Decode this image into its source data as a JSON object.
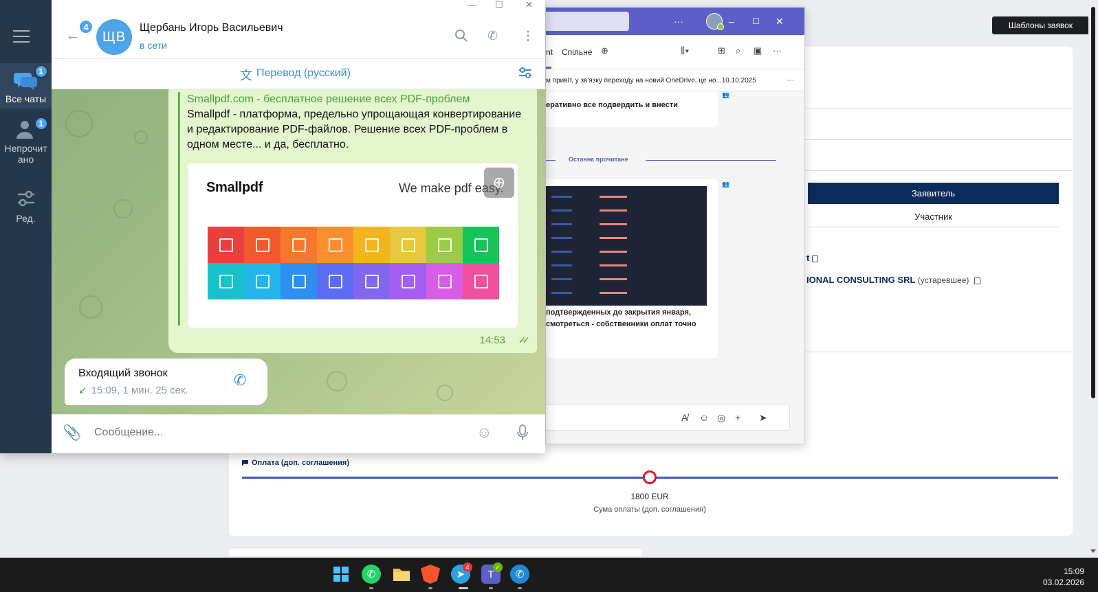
{
  "background_app": {
    "templates_button": "Шаблоны заявок",
    "roles": {
      "applicant": "Заявитель",
      "participant": "Участник"
    },
    "company_fragment_top": "t",
    "company_fragment": "IONAL CONSULTING SRL",
    "company_fragment_status": "(устаревшее)",
    "payment_label": "Оплата (доп. соглашения)",
    "payment_amount": "1800 EUR",
    "payment_caption": "Сума оплаты (доп. соглашения)"
  },
  "teams": {
    "tabs": {
      "fragment": "nt",
      "shared": "Спільне"
    },
    "banner": "м привіт, у зв'язку переходу на новий OneDrive, це но...10.10.2025",
    "message1_fragment": "еративно все подвердить и внести",
    "last_read_label": "Останнє прочитане",
    "message2_line1": "подтвержденных до закрытия января,",
    "message2_line2": "смотреться - собственники оплат точно",
    "accent_color": "#5b5fc7"
  },
  "telegram": {
    "sidebar": {
      "folders": [
        {
          "label": "Все чаты",
          "badge": "1",
          "icon": "chats-icon"
        },
        {
          "label": "Непрочитано",
          "label_lines": [
            "Непрочит",
            "ано"
          ],
          "badge": "1",
          "icon": "unread-icon"
        },
        {
          "label": "Ред.",
          "icon": "edit-folders-icon"
        }
      ]
    },
    "header": {
      "back_badge": "4",
      "avatar_initials": "ЩВ",
      "contact_name": "Щербань Игорь Васильевич",
      "status": "в сети"
    },
    "translate_bar": "Перевод (русский)",
    "outgoing_message": {
      "site_name": "Smallpdf.com - бесплатное решение всех PDF-проблем",
      "description": "Smallpdf - платформа, предельно упрощающая конвертирование и редактирование PDF-файлов. Решение всех PDF-проблем в одном месте... и да, бесплатно.",
      "preview_logo": "Smallpdf",
      "preview_tagline": "We make pdf easy.",
      "time": "14:53",
      "tile_colors": [
        "#e8413c",
        "#f15a2b",
        "#f7782a",
        "#fb8e2c",
        "#f2b41f",
        "#e5c83b",
        "#9acd45",
        "#17c45a",
        "#17c1cb",
        "#23b5e7",
        "#2f8ff0",
        "#5c6cf0",
        "#8267ee",
        "#a45ef0",
        "#d65ee6",
        "#f0509d"
      ]
    },
    "incoming_call": {
      "title": "Входящий звонок",
      "meta": "15:09, 1 мин. 25 сек."
    },
    "composer_placeholder": "Сообщение...",
    "accent_color": "#3a8bd4"
  },
  "taskbar": {
    "time": "15:09",
    "date": "03.02.2026",
    "telegram_badge": "4"
  }
}
